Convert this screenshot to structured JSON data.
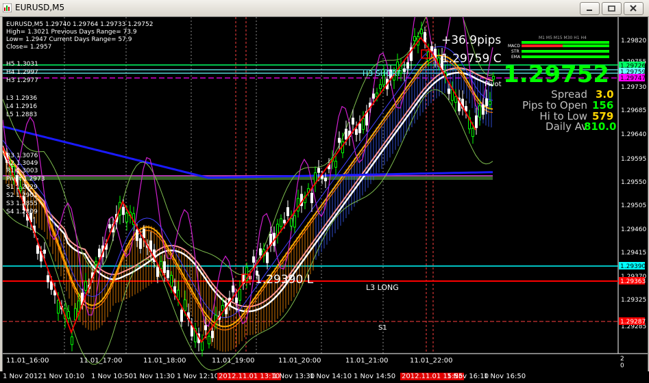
{
  "window": {
    "title": "EURUSD,M5"
  },
  "info": {
    "line1": "EURUSD,M5  1.29740 1.29764 1.29733 1.29752",
    "line2": "High= 1.3021    Previous Days Range= 73.9",
    "line3": "Low= 1.2947     Current Days Range= 57.9",
    "line4": "Close= 1.2957"
  },
  "pivot_levels_top": [
    "H5 1.3031",
    "H4 1.2997",
    "H3 1.2977"
  ],
  "pivot_levels_mid": [
    "L3 1.2936",
    "L4 1.2916",
    "L5 1.2883"
  ],
  "pivot_levels_left": [
    "R3 1.3076",
    "R2 1.3049",
    "R1 1.3003",
    "Pivot 1.2973",
    "S1 1.2929",
    "S2 1.2901",
    "S3 1.2855",
    "S4 1.2809"
  ],
  "annotations": {
    "pips": "+36.9pips",
    "close_price": "1.29759 C",
    "low_price": "1.29390 L",
    "h3_short": "H3 SHORT",
    "l3_long": "L3 LONG",
    "s1": "S1",
    "pivot": "Pivot"
  },
  "big_price": "1.29752",
  "stats": {
    "spread_label": "Spread",
    "spread_value": "3.0",
    "pips_open_label": "Pips to Open",
    "pips_open_value": "156",
    "hi_low_label": "Hi to Low",
    "hi_low_value": "579",
    "daily_label": "Daily Av",
    "daily_value": "810.0"
  },
  "indicator_labels": {
    "tfs": "M1  M5  M15  M30  H1  H4",
    "macd": "MACD",
    "str": "STR",
    "ema": "EMA"
  },
  "price_axis": [
    "1.29820",
    "1.29755",
    "1.29730",
    "1.29685",
    "1.29640",
    "1.29595",
    "1.29550",
    "1.29505",
    "1.29460",
    "1.29415",
    "1.29370",
    "1.29325",
    "1.29285"
  ],
  "price_tags": [
    {
      "text": "1.29726",
      "bg": "#00ff66",
      "fg": "#000"
    },
    {
      "text": "1.29759",
      "bg": "#66ffff",
      "fg": "#000"
    },
    {
      "text": "1.29747",
      "bg": "#ff00ff",
      "fg": "#000"
    },
    {
      "text": "1.29390",
      "bg": "#00ffff",
      "fg": "#000"
    },
    {
      "text": "1.29363",
      "bg": "#ff0000",
      "fg": "#fff"
    },
    {
      "text": "1.29287",
      "bg": "#ff0000",
      "fg": "#fff"
    }
  ],
  "time_axis": [
    "11.01_16:00",
    "11.01_17:00",
    "11.01_18:00",
    "11.01_19:00",
    "11.01_20:00",
    "11.01_21:00",
    "11.01_22:00"
  ],
  "bottom_times": [
    "1 Nov 2012",
    "1 Nov 10:10",
    "1 Nov 10:50",
    "1 Nov 11:30",
    "1 Nov 12:10",
    "2012.11.01 13:10",
    "1 Nov 13:30",
    "1 Nov 14:10",
    "1 Nov 14:50",
    "2012.11.01 15:55",
    "1 Nov 16:10",
    "1 Nov 16:50"
  ],
  "colors": {
    "bg": "#000000",
    "grid": "#ffffff",
    "up": "#00ff00",
    "down": "#ffffff",
    "zigzag": "#ff0000"
  }
}
